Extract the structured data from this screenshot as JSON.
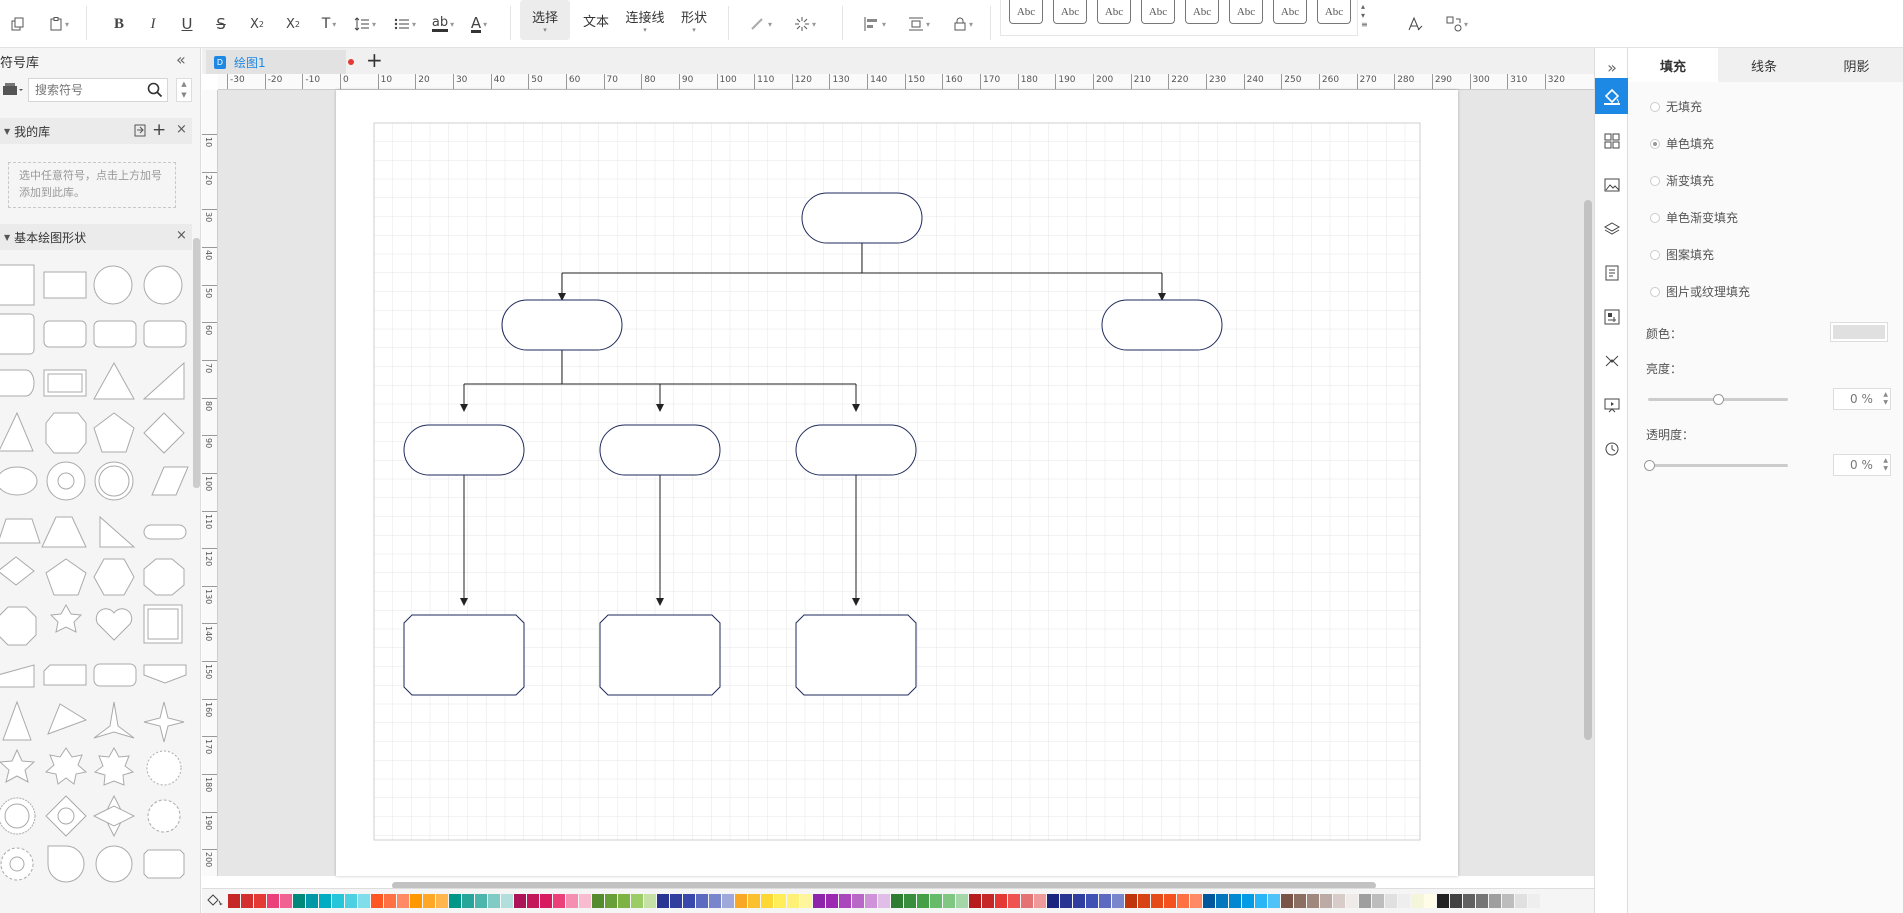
{
  "toolbar": {
    "mode_buttons": [
      "选择",
      "文本",
      "连接线",
      "形状"
    ],
    "style_presets": [
      "Abc",
      "Abc",
      "Abc",
      "Abc",
      "Abc",
      "Abc",
      "Abc",
      "Abc"
    ],
    "font_color_glyph": "A",
    "highlight_glyph": "ab",
    "text_glyph": "T"
  },
  "left_panel": {
    "title": "符号库",
    "search_placeholder": "搜索符号",
    "my_library": {
      "title": "我的库",
      "hint": "选中任意符号，点击上方加号添加到此库。"
    },
    "basic_shapes": {
      "title": "基本绘图形状"
    }
  },
  "tabs": [
    {
      "label": "绘图1",
      "unsaved": true
    }
  ],
  "ruler": {
    "h_ticks": [
      "-30",
      "-20",
      "-10",
      "0",
      "10",
      "20",
      "30",
      "40",
      "50",
      "60",
      "70",
      "80",
      "90",
      "100",
      "110",
      "120",
      "130",
      "140",
      "150",
      "160",
      "170",
      "180",
      "190",
      "200",
      "210",
      "220",
      "230",
      "240",
      "250",
      "260",
      "270",
      "280",
      "290",
      "300",
      "310",
      "320"
    ],
    "v_ticks": [
      "10",
      "20",
      "30",
      "40",
      "50",
      "60",
      "70",
      "80",
      "90",
      "100",
      "110",
      "120",
      "130",
      "140",
      "150",
      "160",
      "170",
      "180",
      "190",
      "200"
    ]
  },
  "right_panel": {
    "tabs": [
      "填充",
      "线条",
      "阴影"
    ],
    "active_tab": "填充",
    "fill_options": [
      "无填充",
      "单色填充",
      "渐变填充",
      "单色渐变填充",
      "图案填充",
      "图片或纹理填充"
    ],
    "selected_fill": "单色填充",
    "color_label": "颜色：",
    "color_value": "#e0e0e0",
    "brightness_label": "亮度：",
    "brightness_value": "0 %",
    "transparency_label": "透明度：",
    "transparency_value": "0 %"
  },
  "colors": {
    "accent": "#1e88e5",
    "shape_stroke": "#1f2a5c",
    "grid": "#e3e3e3"
  },
  "palette": [
    "#c62828",
    "#d32f2f",
    "#e53935",
    "#ec407a",
    "#f06292",
    "#00897b",
    "#0097a7",
    "#00acc1",
    "#26c6da",
    "#4dd0e1",
    "#80deea",
    "#ff5722",
    "#ff7043",
    "#ff8a65",
    "#ff9800",
    "#ffa726",
    "#ffb74d",
    "#009688",
    "#26a69a",
    "#4db6ac",
    "#80cbc4",
    "#b2dfdb",
    "#ad1457",
    "#c2185b",
    "#d81b60",
    "#ec407a",
    "#f48fb1",
    "#f8bbd0",
    "#558b2f",
    "#689f38",
    "#7cb342",
    "#9ccc65",
    "#c5e1a5",
    "#283593",
    "#303f9f",
    "#3949ab",
    "#5c6bc0",
    "#7986cb",
    "#9fa8da",
    "#f9a825",
    "#fbc02d",
    "#fdd835",
    "#ffee58",
    "#fff176",
    "#fff59d",
    "#8e24aa",
    "#9c27b0",
    "#ab47bc",
    "#ba68c8",
    "#ce93d8",
    "#e1bee7",
    "#2e7d32",
    "#388e3c",
    "#43a047",
    "#66bb6a",
    "#81c784",
    "#a5d6a7",
    "#b71c1c",
    "#c62828",
    "#e53935",
    "#ef5350",
    "#e57373",
    "#ef9a9a",
    "#1a237e",
    "#283593",
    "#303f9f",
    "#3f51b5",
    "#5c6bc0",
    "#7986cb",
    "#bf360c",
    "#d84315",
    "#e64a19",
    "#f4511e",
    "#ff7043",
    "#ff8a65",
    "#01579b",
    "#0277bd",
    "#0288d1",
    "#039be5",
    "#29b6f6",
    "#4fc3f7",
    "#795548",
    "#8d6e63",
    "#a1887f",
    "#bcaaa4",
    "#d7ccc8",
    "#efebe9",
    "#9e9e9e",
    "#bdbdbd",
    "#e0e0e0",
    "#eeeeee",
    "#f5f5dc",
    "#fffde7",
    "#212121",
    "#424242",
    "#616161",
    "#757575",
    "#9e9e9e",
    "#bdbdbd",
    "#e0e0e0",
    "#eeeeee",
    "#f5f5f5"
  ]
}
